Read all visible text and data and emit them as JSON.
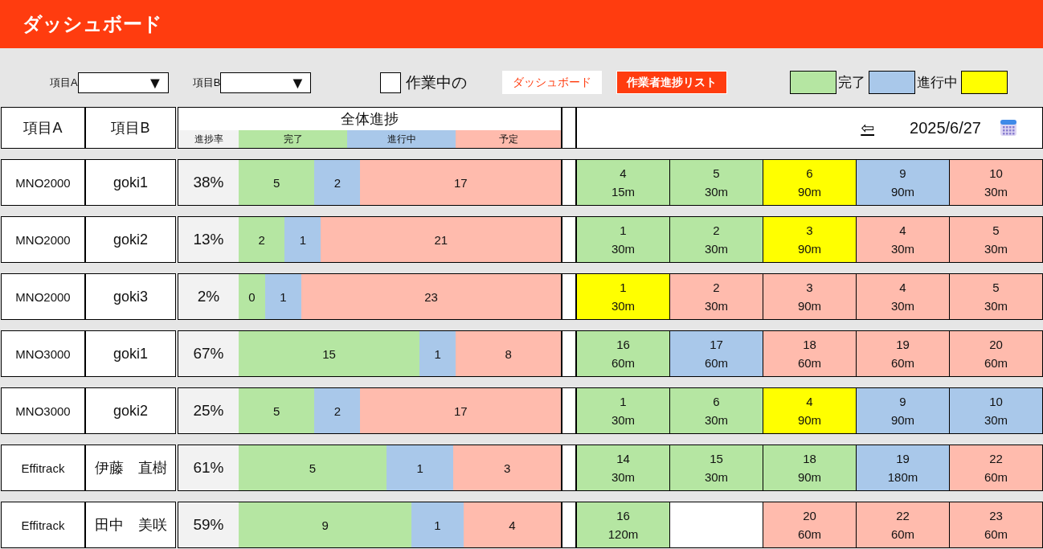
{
  "header": {
    "title": "ダッシュボード"
  },
  "filters": [
    {
      "label": "項目A",
      "arrow": "▼"
    },
    {
      "label": "項目B",
      "arrow": "▼"
    }
  ],
  "only_working": {
    "label": "作業中の",
    "checked": false
  },
  "nav_buttons": [
    {
      "label": "ダッシュボード",
      "selected": true
    },
    {
      "label": "作業者進捗リスト",
      "selected": false
    }
  ],
  "legend": [
    {
      "label": "完了",
      "color": "#b5e6a2"
    },
    {
      "label": "進行中",
      "color": "#a9c8ea"
    },
    {
      "color": "#ffff00"
    }
  ],
  "table": {
    "columns": [
      "項目A",
      "項目B"
    ],
    "overall": {
      "title": "全体進捗",
      "subcolumns": [
        "進捗率",
        "完了",
        "進行中",
        "予定"
      ]
    },
    "date_nav": {
      "back": "⇦",
      "date": "2025/6/27"
    },
    "rows": [
      {
        "item_a": "MNO2000",
        "item_b": "goki1",
        "rate": "38%",
        "done": "5",
        "progress": "2",
        "planned": "17",
        "tasks": [
          {
            "kind": "done",
            "number": "4",
            "time": "15m"
          },
          {
            "kind": "done",
            "number": "5",
            "time": "30m"
          },
          {
            "kind": "active",
            "number": "6",
            "time": "90m"
          },
          {
            "kind": "progress",
            "number": "9",
            "time": "90m"
          },
          {
            "kind": "planned",
            "number": "10",
            "time": "30m"
          }
        ]
      },
      {
        "item_a": "MNO2000",
        "item_b": "goki2",
        "rate": "13%",
        "done": "2",
        "progress": "1",
        "planned": "21",
        "tasks": [
          {
            "kind": "done",
            "number": "1",
            "time": "30m"
          },
          {
            "kind": "done",
            "number": "2",
            "time": "30m"
          },
          {
            "kind": "active",
            "number": "3",
            "time": "90m"
          },
          {
            "kind": "planned",
            "number": "4",
            "time": "30m"
          },
          {
            "kind": "planned",
            "number": "5",
            "time": "30m"
          }
        ]
      },
      {
        "item_a": "MNO2000",
        "item_b": "goki3",
        "rate": "2%",
        "done": "0",
        "progress": "1",
        "planned": "23",
        "tasks": [
          {
            "kind": "active",
            "number": "1",
            "time": "30m"
          },
          {
            "kind": "planned",
            "number": "2",
            "time": "30m"
          },
          {
            "kind": "planned",
            "number": "3",
            "time": "90m"
          },
          {
            "kind": "planned",
            "number": "4",
            "time": "30m"
          },
          {
            "kind": "planned",
            "number": "5",
            "time": "30m"
          }
        ]
      },
      {
        "item_a": "MNO3000",
        "item_b": "goki1",
        "rate": "67%",
        "done": "15",
        "progress": "1",
        "planned": "8",
        "tasks": [
          {
            "kind": "done",
            "number": "16",
            "time": "60m"
          },
          {
            "kind": "progress",
            "number": "17",
            "time": "60m"
          },
          {
            "kind": "planned",
            "number": "18",
            "time": "60m"
          },
          {
            "kind": "planned",
            "number": "19",
            "time": "60m"
          },
          {
            "kind": "planned",
            "number": "20",
            "time": "60m"
          }
        ]
      },
      {
        "item_a": "MNO3000",
        "item_b": "goki2",
        "rate": "25%",
        "done": "5",
        "progress": "2",
        "planned": "17",
        "tasks": [
          {
            "kind": "done",
            "number": "1",
            "time": "30m"
          },
          {
            "kind": "done",
            "number": "6",
            "time": "30m"
          },
          {
            "kind": "active",
            "number": "4",
            "time": "90m"
          },
          {
            "kind": "progress",
            "number": "9",
            "time": "90m"
          },
          {
            "kind": "progress",
            "number": "10",
            "time": "30m"
          }
        ]
      },
      {
        "item_a": "Effitrack",
        "item_b": "伊藤　直樹",
        "rate": "61%",
        "done": "5",
        "progress": "1",
        "planned": "3",
        "tasks": [
          {
            "kind": "done",
            "number": "14",
            "time": "30m"
          },
          {
            "kind": "done",
            "number": "15",
            "time": "30m"
          },
          {
            "kind": "done",
            "number": "18",
            "time": "90m"
          },
          {
            "kind": "progress",
            "number": "19",
            "time": "180m"
          },
          {
            "kind": "planned",
            "number": "22",
            "time": "60m"
          }
        ]
      },
      {
        "item_a": "Effitrack",
        "item_b": "田中　美咲",
        "rate": "59%",
        "done": "9",
        "progress": "1",
        "planned": "4",
        "tasks": [
          {
            "kind": "done",
            "number": "16",
            "time": "120m"
          },
          {
            "kind": "empty"
          },
          {
            "kind": "planned",
            "number": "20",
            "time": "60m"
          },
          {
            "kind": "planned",
            "number": "22",
            "time": "60m"
          },
          {
            "kind": "planned",
            "number": "23",
            "time": "60m"
          }
        ]
      }
    ]
  }
}
